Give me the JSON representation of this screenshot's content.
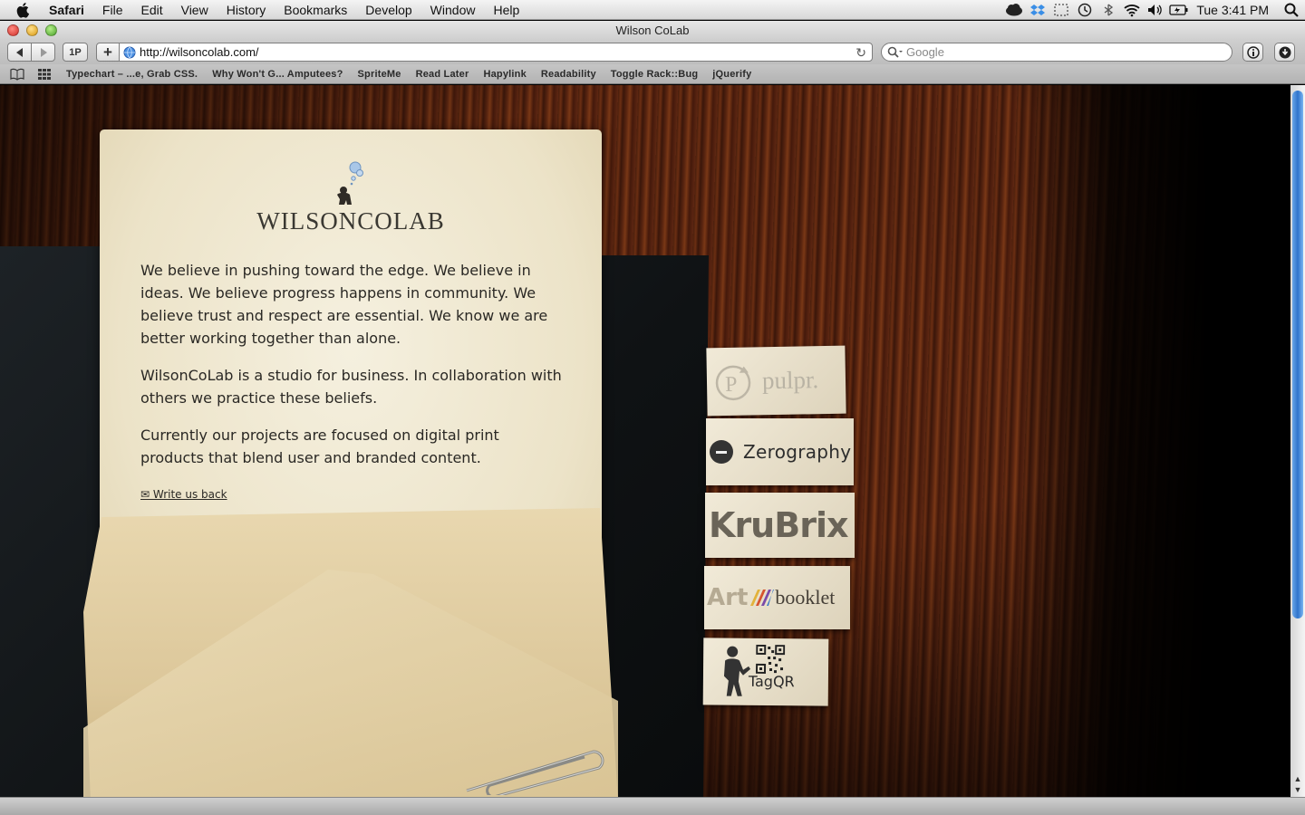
{
  "menubar": {
    "app_name": "Safari",
    "items": [
      "File",
      "Edit",
      "View",
      "History",
      "Bookmarks",
      "Develop",
      "Window",
      "Help"
    ],
    "clock": "Tue 3:41 PM"
  },
  "window": {
    "title": "Wilson CoLab"
  },
  "toolbar": {
    "onepassword_label": "1P",
    "add_label": "+",
    "url": "http://wilsoncolab.com/",
    "search_placeholder": "Google"
  },
  "bookmarks": [
    "Typechart – ...e, Grab CSS.",
    "Why Won't G... Amputees?",
    "SpriteMe",
    "Read Later",
    "Hapylink",
    "Readability",
    "Toggle Rack::Bug",
    "jQuerify"
  ],
  "page": {
    "logo_text": "WILSONCOLAB",
    "paragraph_1": "We believe in pushing toward the edge. We believe in ideas. We believe progress happens in community. We believe trust and respect are essential. We know we are better working together than alone.",
    "paragraph_2": "WilsonCoLab is a studio for business. In collaboration with others we practice these beliefs.",
    "paragraph_3": "Currently our projects are focused on digital print products that blend user and branded content.",
    "write_back": "✉ Write us back"
  },
  "projects": {
    "pulpr": "pulpr.",
    "zerography": "Zerography",
    "krubrix": "KruBrix",
    "artbooklet_art": "Art",
    "artbooklet_booklet": "booklet",
    "tagqr": "TagQR"
  },
  "colors": {
    "wood": "#5a2510",
    "paper": "#f1ead8",
    "scroll_thumb": "#2f74cc"
  }
}
